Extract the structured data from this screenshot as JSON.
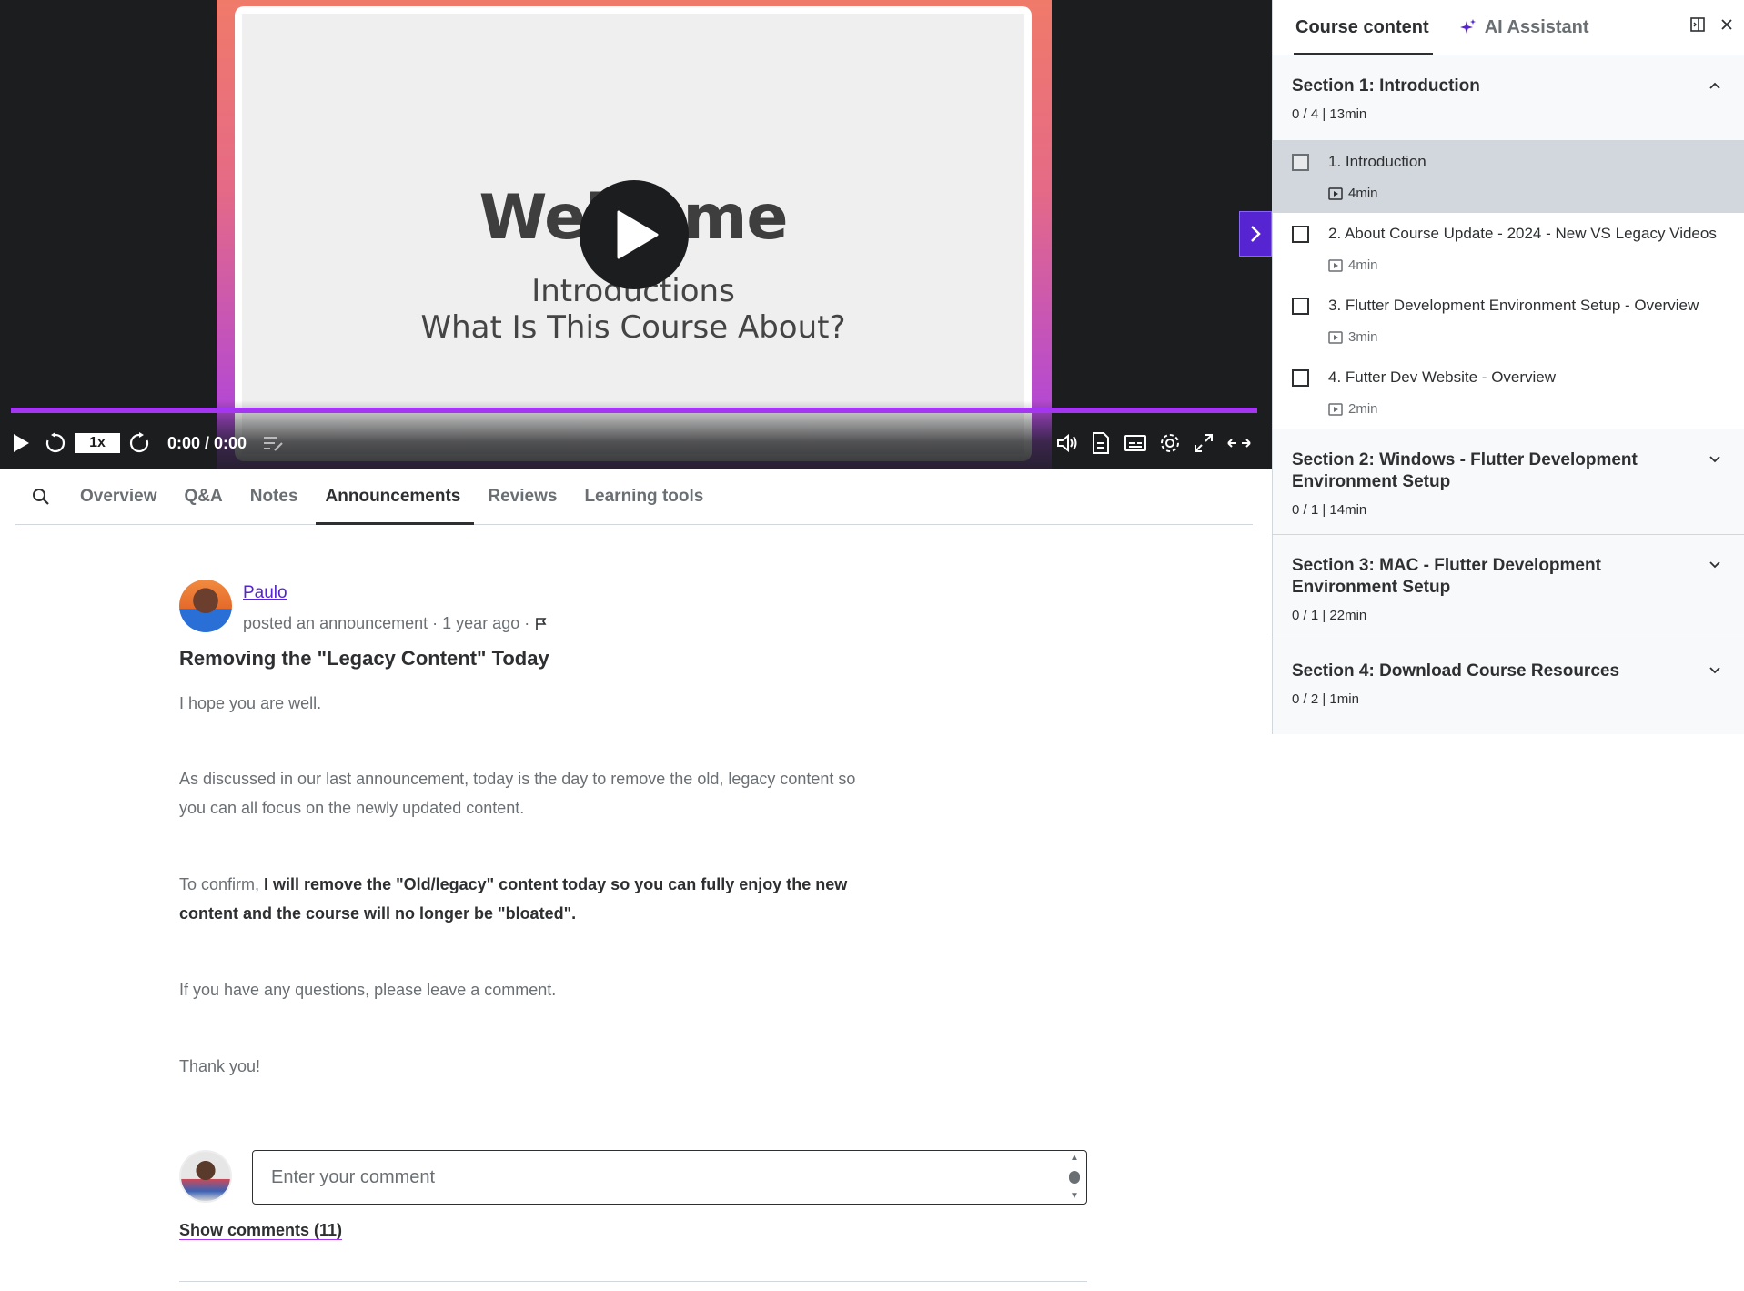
{
  "video": {
    "slide_title": "Welcome",
    "slide_sub1": "Introductions",
    "slide_sub2": "What Is This Course About?",
    "speed": "1x",
    "time": "0:00 / 0:00",
    "progress": 1.0
  },
  "tabs": {
    "items": [
      {
        "label": "Overview"
      },
      {
        "label": "Q&A"
      },
      {
        "label": "Notes"
      },
      {
        "label": "Announcements"
      },
      {
        "label": "Reviews"
      },
      {
        "label": "Learning tools"
      }
    ],
    "active": "Announcements"
  },
  "announcement": {
    "author": "Paulo",
    "posted": "posted an announcement · 1 year ago ·",
    "title": "Removing the \"Legacy Content\" Today",
    "p1": "I hope you are well.",
    "p2": "As discussed in our last announcement, today is the day to remove the old, legacy content so you can all focus on the newly updated content.",
    "p3_prefix": "To confirm, ",
    "p3_bold": "I will remove the \"Old/legacy\" content today so you can fully enjoy the new content and the course will no longer be \"bloated\".",
    "p4": "If you have any questions, please leave a comment.",
    "p5": "Thank you!",
    "comment_placeholder": "Enter your comment",
    "show_comments": "Show comments (11)"
  },
  "sidebar": {
    "tab_course": "Course content",
    "tab_ai": "AI Assistant",
    "sections": [
      {
        "title": "Section 1: Introduction",
        "meta": "0 / 4 | 13min",
        "expanded": true,
        "lectures": [
          {
            "title": "1. Introduction",
            "duration": "4min"
          },
          {
            "title": "2. About Course Update - 2024 - New VS Legacy Videos",
            "duration": "4min"
          },
          {
            "title": "3. Flutter Development Environment Setup - Overview",
            "duration": "3min"
          },
          {
            "title": "4. Futter Dev Website - Overview",
            "duration": "2min"
          }
        ]
      },
      {
        "title": "Section 2: Windows - Flutter Development Environment Setup",
        "meta": "0 / 1 | 14min"
      },
      {
        "title": "Section 3: MAC - Flutter Development Environment Setup",
        "meta": "0 / 1 | 22min"
      },
      {
        "title": "Section 4: Download Course Resources",
        "meta": "0 / 2 | 1min"
      }
    ]
  },
  "colors": {
    "accent": "#5624d0",
    "progress": "#a435f0",
    "video_bg": "#1c1d1f"
  },
  "icons": [
    "play-icon",
    "rewind-icon",
    "forward-icon",
    "transcript-icon",
    "volume-icon",
    "notes-icon",
    "captions-icon",
    "settings-icon",
    "fullscreen-icon",
    "expand-icon",
    "search-icon",
    "sparkle-icon",
    "panel-icon",
    "close-icon",
    "chevron-up-icon",
    "chevron-down-icon",
    "video-icon",
    "flag-icon",
    "chevron-right-icon"
  ]
}
